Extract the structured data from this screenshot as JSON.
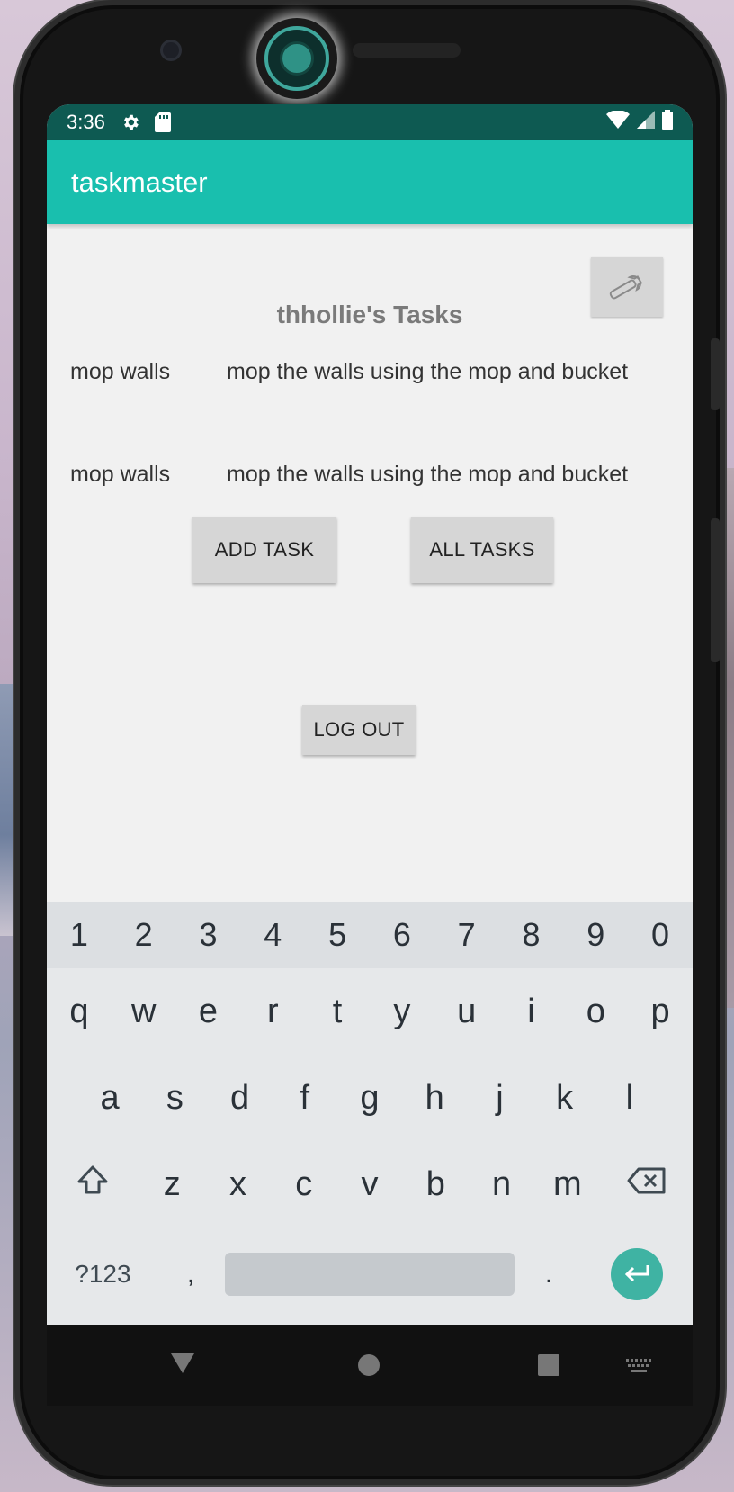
{
  "status_bar": {
    "time": "3:36",
    "icons": [
      "settings-icon",
      "sd-card-icon",
      "wifi-icon",
      "signal-icon",
      "battery-icon"
    ]
  },
  "app_bar": {
    "title": "taskmaster"
  },
  "main": {
    "title": "thhollie's Tasks",
    "settings_icon": "wrench-icon",
    "tasks": [
      {
        "title": "mop walls",
        "body": "mop the walls using the mop and bucket"
      },
      {
        "title": "mop walls",
        "body": "mop the walls using the mop and bucket"
      }
    ],
    "add_task_label": "ADD TASK",
    "all_tasks_label": "ALL TASKS",
    "logout_label": "LOG OUT"
  },
  "keyboard": {
    "numbers": [
      "1",
      "2",
      "3",
      "4",
      "5",
      "6",
      "7",
      "8",
      "9",
      "0"
    ],
    "row1": [
      "q",
      "w",
      "e",
      "r",
      "t",
      "y",
      "u",
      "i",
      "o",
      "p"
    ],
    "row2": [
      "a",
      "s",
      "d",
      "f",
      "g",
      "h",
      "j",
      "k",
      "l"
    ],
    "row3": [
      "z",
      "x",
      "c",
      "v",
      "b",
      "n",
      "m"
    ],
    "symbols_label": "?123",
    "comma": ",",
    "period": ".",
    "shift_icon": "shift-icon",
    "backspace_icon": "backspace-icon",
    "enter_icon": "enter-icon"
  },
  "nav_bar": {
    "icons": [
      "back-icon",
      "home-icon",
      "recents-icon",
      "keyboard-switch-icon"
    ]
  },
  "colors": {
    "status_bar": "#0e5a52",
    "app_bar": "#19bfae",
    "background": "#f1f1f1",
    "button": "#d6d6d6",
    "enter_key": "#3fb3a3"
  }
}
